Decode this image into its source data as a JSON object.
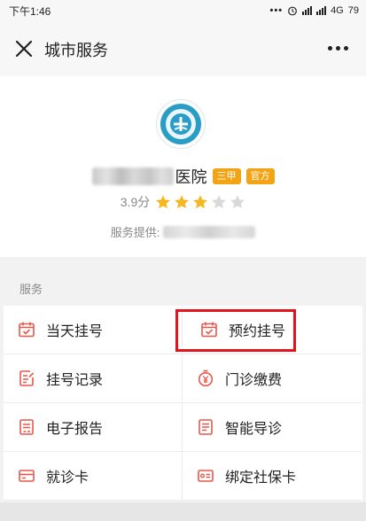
{
  "status_bar": {
    "time": "下午1:46",
    "right_text": "4G",
    "battery": "79"
  },
  "nav": {
    "title": "城市服务",
    "close_icon": "close-icon",
    "more_icon": "more-icon"
  },
  "hospital": {
    "name_suffix": "医院",
    "badges": [
      "三甲",
      "官方"
    ],
    "rating_text": "3.9分",
    "rating_value": 3.9,
    "rating_max": 5,
    "provider_label": "服务提供:"
  },
  "services": {
    "section_label": "服务",
    "items": [
      {
        "label": "当天挂号",
        "icon": "calendar-check-icon"
      },
      {
        "label": "预约挂号",
        "icon": "calendar-check-icon"
      },
      {
        "label": "挂号记录",
        "icon": "document-edit-icon"
      },
      {
        "label": "门诊缴费",
        "icon": "yen-coin-icon"
      },
      {
        "label": "电子报告",
        "icon": "report-icon"
      },
      {
        "label": "智能导诊",
        "icon": "guide-list-icon"
      },
      {
        "label": "就诊卡",
        "icon": "card-icon"
      },
      {
        "label": "绑定社保卡",
        "icon": "id-card-icon"
      }
    ]
  },
  "colors": {
    "icon_red": "#e8574a",
    "badge_orange": "#f2a414",
    "star_gold": "#f5b820",
    "star_gray": "#d9d9d9",
    "highlight_red": "#e3141c"
  }
}
